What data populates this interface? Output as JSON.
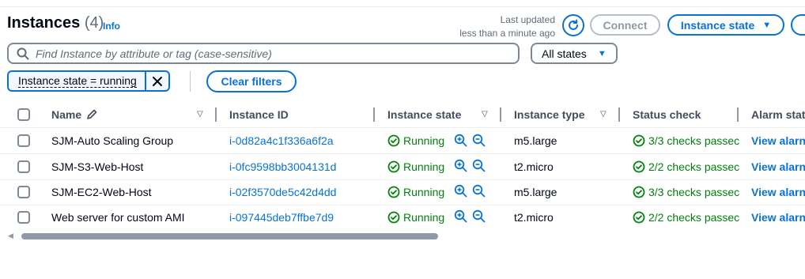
{
  "header": {
    "title": "Instances",
    "count": "(4)",
    "info": "Info",
    "last_updated_line1": "Last updated",
    "last_updated_line2": "less than a minute ago",
    "connect_label": "Connect",
    "instance_state_label": "Instance state"
  },
  "filter": {
    "search_placeholder": "Find Instance by attribute or tag (case-sensitive)",
    "state_select": "All states",
    "token_label": "Instance state = running",
    "clear_label": "Clear filters"
  },
  "table": {
    "columns": {
      "name": "Name",
      "instance_id": "Instance ID",
      "instance_state": "Instance state",
      "instance_type": "Instance type",
      "status_check": "Status check",
      "alarm_status": "Alarm stat"
    },
    "rows": [
      {
        "name": "SJM-Auto Scaling Group",
        "id": "i-0d82a4c1f336a6f2a",
        "state": "Running",
        "type": "m5.large",
        "status": "3/3 checks passec",
        "alarm": "View alarn"
      },
      {
        "name": "SJM-S3-Web-Host",
        "id": "i-0fc9598bb3004131d",
        "state": "Running",
        "type": "t2.micro",
        "status": "2/2 checks passec",
        "alarm": "View alarn"
      },
      {
        "name": "SJM-EC2-Web-Host",
        "id": "i-02f3570de5c42d4dd",
        "state": "Running",
        "type": "m5.large",
        "status": "3/3 checks passec",
        "alarm": "View alarn"
      },
      {
        "name": "Web server for custom AMI",
        "id": "i-097445deb7ffbe7d9",
        "state": "Running",
        "type": "t2.micro",
        "status": "2/2 checks passec",
        "alarm": "View alarn"
      }
    ]
  },
  "colors": {
    "accent": "#0972d3",
    "success": "#037f0c",
    "text": "#000716"
  },
  "icons": [
    "refresh-icon",
    "caret-down-icon",
    "search-icon",
    "close-icon",
    "pencil-icon",
    "sort-caret-icon",
    "check-circle-icon",
    "zoom-in-icon",
    "zoom-out-icon"
  ]
}
